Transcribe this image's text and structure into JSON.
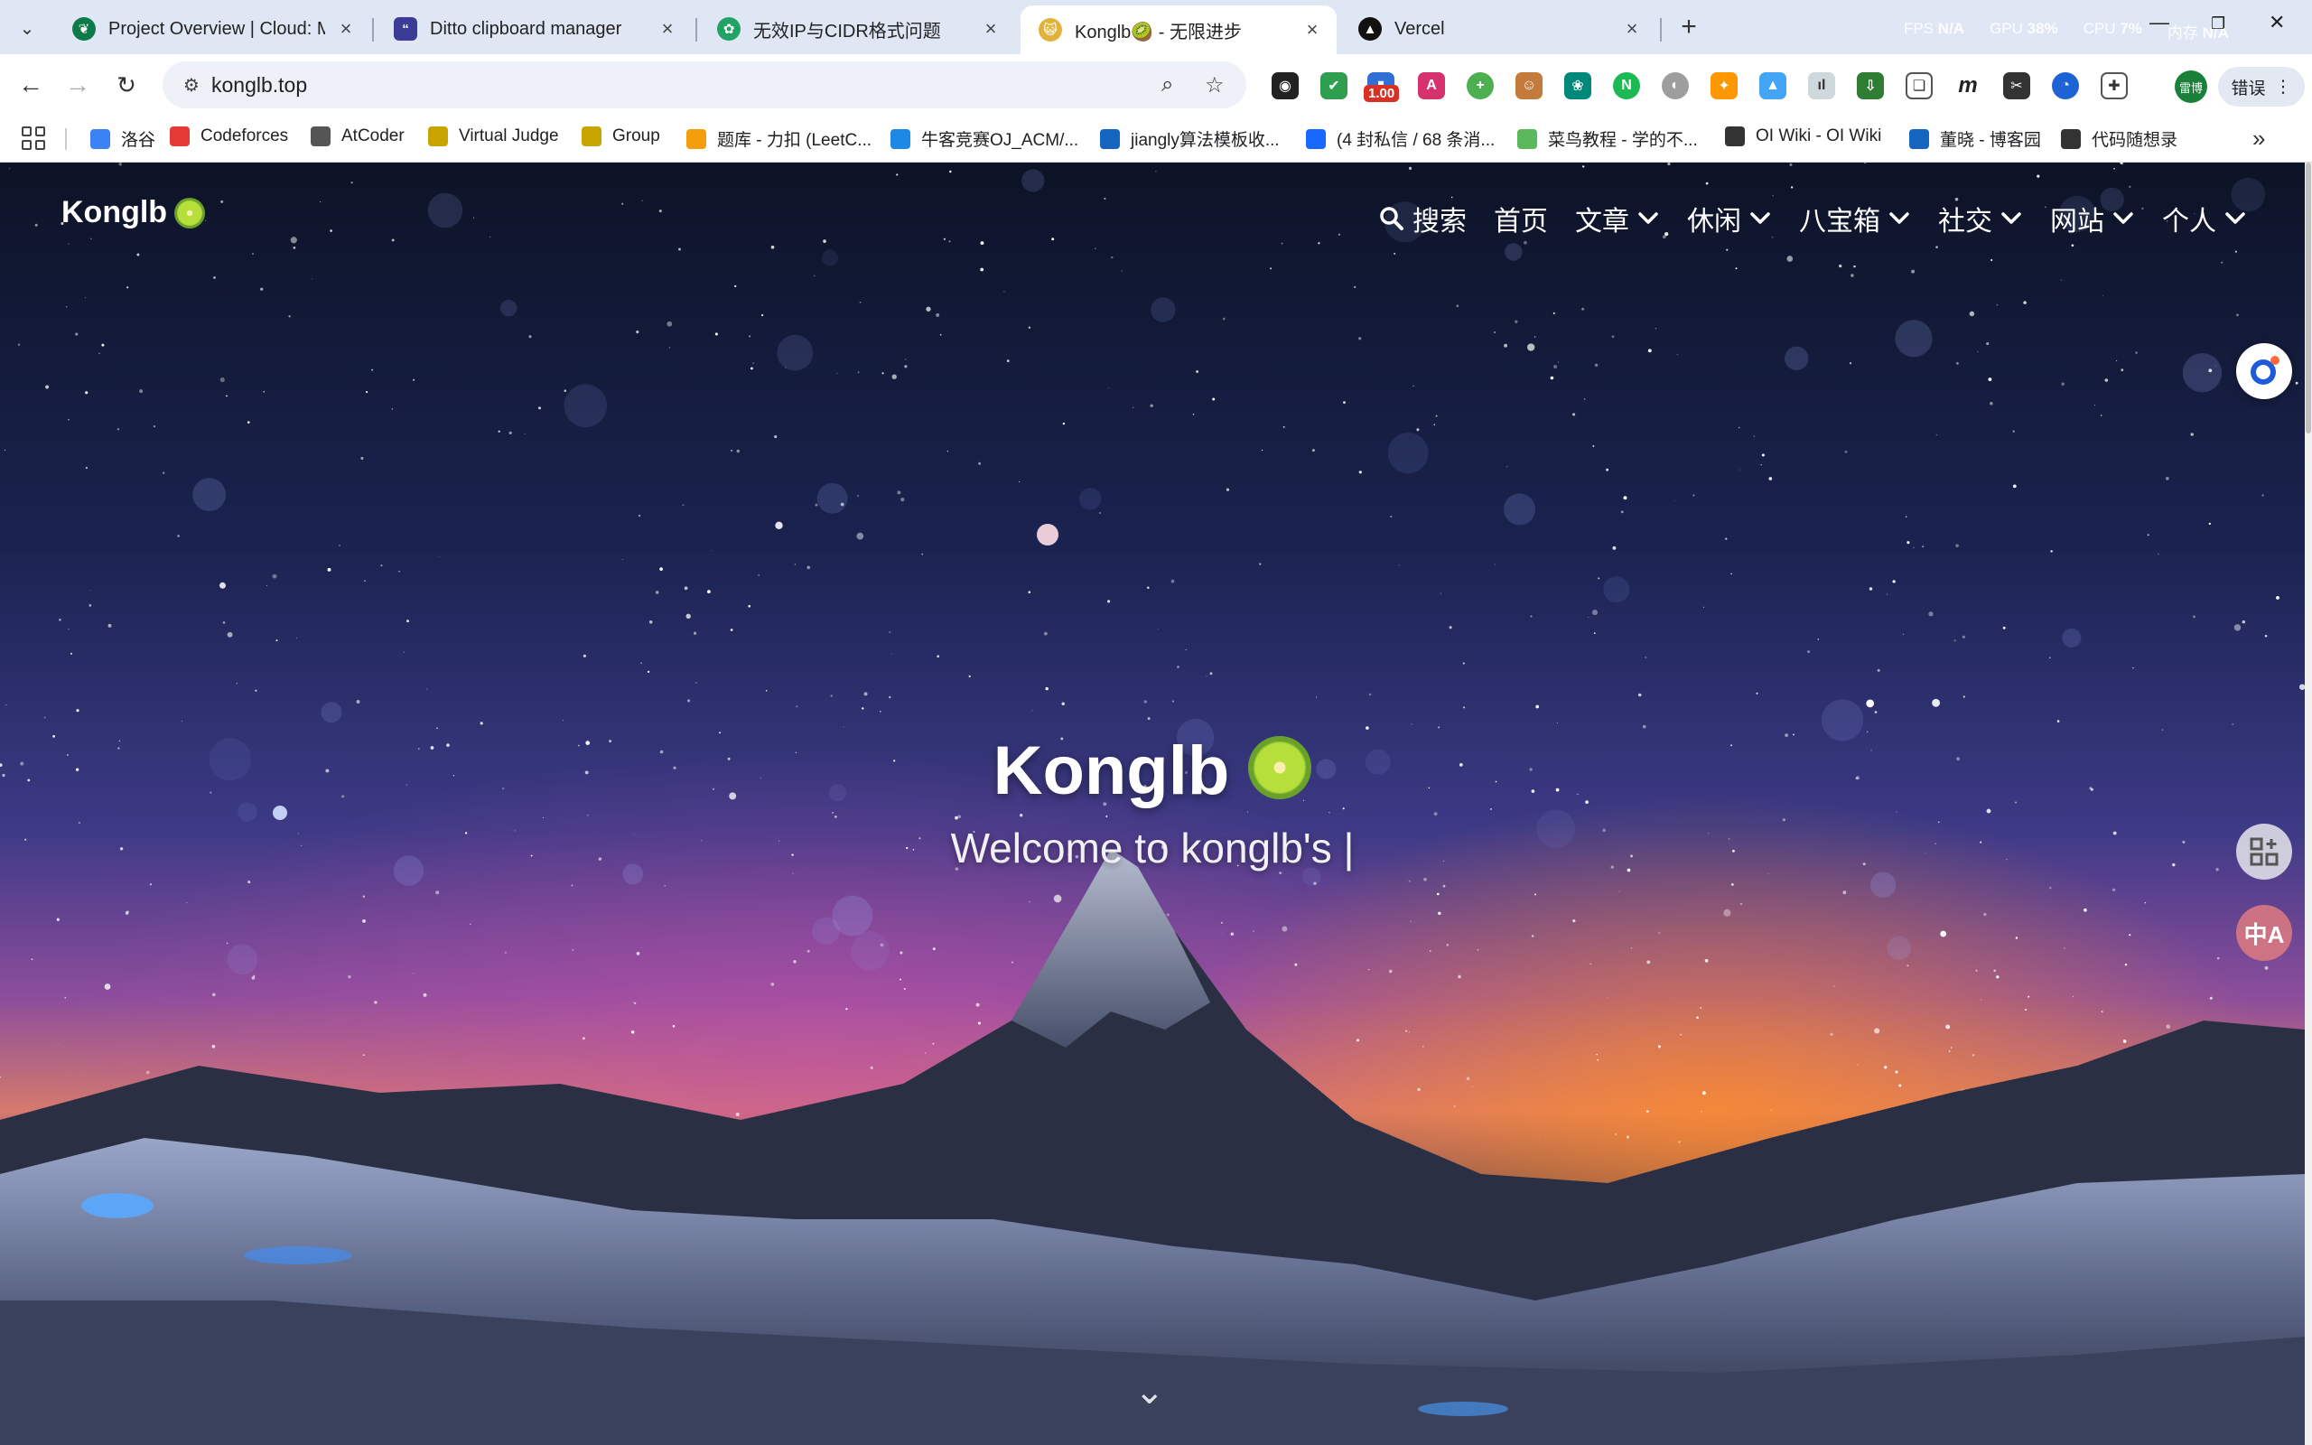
{
  "browser": {
    "tabs": [
      {
        "title": "Project Overview | Cloud: Mo",
        "favicon_color": "#0e7a4a"
      },
      {
        "title": "Ditto clipboard manager",
        "favicon_color": "#3b3b98"
      },
      {
        "title": "无效IP与CIDR格式问题",
        "favicon_color": "#22a366"
      },
      {
        "title": "Konglb🥝 - 无限进步",
        "favicon_color": "#e2b33a"
      },
      {
        "title": "Vercel",
        "favicon_color": "#111111"
      }
    ],
    "active_tab": 3,
    "perf": {
      "fps_label": "FPS",
      "fps_value": "N/A",
      "gpu_label": "GPU",
      "gpu_value": "38%",
      "cpu_label": "CPU",
      "cpu_value": "7%",
      "mem_label": "内存",
      "mem_value": "N/A"
    },
    "url": "konglb.top",
    "zoom_badge": "1.00",
    "profile_label": "雷博",
    "error_label": "错误",
    "bookmarks": [
      {
        "label": "洛谷",
        "color": "#3b82f6"
      },
      {
        "label": "Codeforces",
        "color": "#e53935"
      },
      {
        "label": "AtCoder",
        "color": "#555555"
      },
      {
        "label": "Virtual Judge",
        "color": "#c9a400"
      },
      {
        "label": "Group",
        "color": "#c9a400"
      },
      {
        "label": "题库 - 力扣 (LeetC...",
        "color": "#f59e0b"
      },
      {
        "label": "牛客竞赛OJ_ACM/...",
        "color": "#1e88e5"
      },
      {
        "label": "jiangly算法模板收...",
        "color": "#1565c0"
      },
      {
        "label": "(4 封私信 / 68 条消...",
        "color": "#1769ff"
      },
      {
        "label": "菜鸟教程 - 学的不...",
        "color": "#5cb85c"
      },
      {
        "label": "OI Wiki - OI Wiki",
        "color": "#333333"
      },
      {
        "label": "董晓 - 博客园",
        "color": "#1565c0"
      },
      {
        "label": "代码随想录",
        "color": "#333333"
      }
    ]
  },
  "site": {
    "logo": "Konglb",
    "nav": [
      {
        "label": "搜索",
        "icon": "search-icon",
        "dropdown": false
      },
      {
        "label": "首页",
        "dropdown": false
      },
      {
        "label": "文章",
        "dropdown": true
      },
      {
        "label": "休闲",
        "dropdown": true
      },
      {
        "label": "八宝箱",
        "dropdown": true
      },
      {
        "label": "社交",
        "dropdown": true
      },
      {
        "label": "网站",
        "dropdown": true
      },
      {
        "label": "个人",
        "dropdown": true
      }
    ],
    "hero_title": "Konglb",
    "hero_subtitle": "Welcome to konglb's |"
  }
}
